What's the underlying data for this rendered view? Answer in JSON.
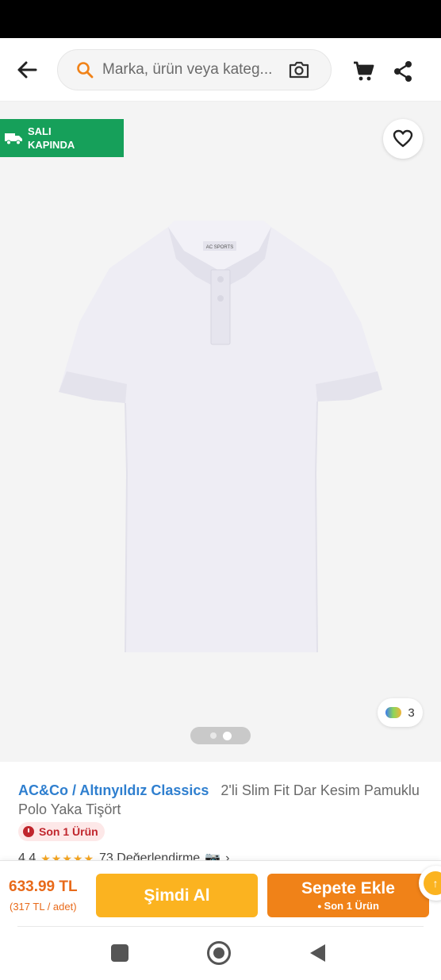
{
  "header": {
    "search_placeholder": "Marka, ürün veya kateg..."
  },
  "gallery": {
    "delivery_badge": "SALI\nKAPINDA",
    "color_count": "3",
    "page_index": 2,
    "page_total": 2
  },
  "product": {
    "brand": "AC&Co / Altınyıldız Classics",
    "name": "2'li Slim Fit Dar Kesim Pamuklu Polo Yaka Tişört",
    "stock_badge": "Son 1 Ürün",
    "rating": "4.4",
    "stars": "★★★★★",
    "reviews": "73 Değerlendirme",
    "reviews_icon": "📷",
    "reviews_arrow": "›"
  },
  "buy_bar": {
    "price": "633.99 TL",
    "unit_price": "(317 TL / adet)",
    "buy_now_label": "Şimdi Al",
    "add_cart_label": "Sepete Ekle",
    "add_cart_sub": "Son 1 Ürün",
    "accent_color": "#f08218",
    "buy_now_color": "#fbb320"
  }
}
